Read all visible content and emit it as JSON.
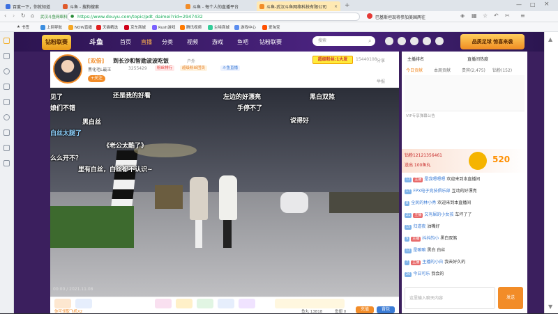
{
  "browser": {
    "tabs": [
      {
        "label": "百度一下，你就知道",
        "color": "#3b6fe0"
      },
      {
        "label": "斗鱼 - 搜狗搜索",
        "color": "#e05a2b"
      },
      {
        "label": "斗鱼 - 每个人的直播平台",
        "color": "#f28c28"
      },
      {
        "label": "斗鱼-武汉斗鱼网络科技有限公司",
        "color": "#f28c28"
      }
    ],
    "security_label": "武汉斗鱼网络科技有限公司",
    "url": "https://www.douyu.com/topic/pdt_daimei?rid=2947432",
    "news_text": "巴基斯坦现将参加美国两往",
    "bookmarks": [
      "书签",
      "上网导航",
      "NOW直播",
      "天猫精选",
      "京东商城",
      "Rush游戏",
      "腾讯视频",
      "尘埃商城",
      "游戏中心",
      "爱淘宝"
    ]
  },
  "site": {
    "logo": "斗鱼",
    "nav": [
      "首页",
      "直播",
      "分类",
      "视频",
      "游戏",
      "鱼吧",
      "钻粉联赛"
    ],
    "search_placeholder": "搜索",
    "promo": "钻粉联赛",
    "promo_banner": "品质足球 惊喜来袭"
  },
  "stream": {
    "tag": "[双倍]",
    "title": "到长沙和智勋波波吃饭",
    "follow_label": "+关注",
    "category": "户外",
    "streamer": "黑化毛L最王",
    "popularity": "3255429",
    "room_tags": [
      "粉丝排行",
      "超级粉丝团员",
      "斗鱼直播"
    ],
    "hot_label": "超级粉丝",
    "hot_value": "1大发",
    "room_id": "15440108",
    "share_label": "分享",
    "report_label": "举报"
  },
  "video_danmaku": [
    "见了",
    "还是我的好看",
    "左边的好漂亮",
    "黑白双煞",
    "娘们不错",
    "手停不了",
    "黑白丝",
    "说得好",
    "白丝太腿了",
    "《老公太酷了》",
    "么么开不？",
    "里有白丝，白丝都不认识~"
  ],
  "player": {
    "time": "00:00 / 2021.11.08",
    "gift_labels": [
      "超粉大厅",
      "充值",
      "福利大厅",
      "乐享",
      "乐发",
      "大豪猪",
      "宝箱"
    ],
    "hint": "你可领取飞机X2",
    "fish_label": "鱼丸 13818",
    "fishcoin_label": "鱼翅 0",
    "recharge_button": "充值",
    "bag_button": "背包"
  },
  "chat": {
    "rank_title": "主播排名",
    "heat_title": "直播间热度",
    "tabs": [
      "今日贡献",
      "本周贡献",
      "贵宾(2,475)",
      "钻粉(152)"
    ],
    "vip_note": "VIP专享弹幕公告",
    "gift_banner": {
      "user": "钻粉12121356461",
      "text": "送出 100鱼丸",
      "count": "520"
    },
    "lines": [
      {
        "level": "12",
        "badge": "主播",
        "nick": "是我嗯嗯嗯",
        "msg": "欢迎来到本直播间"
      },
      {
        "level": "17",
        "badge": "",
        "nick": "FPX电子竞技俱乐部",
        "msg": "互动的好漂亮"
      },
      {
        "level": "8",
        "badge": "",
        "nick": "全民的林小秀",
        "msg": "欢迎来到本直播间"
      },
      {
        "level": "21",
        "badge": "主播",
        "nick": "又有屎的小女孩",
        "msg": "车坏了了"
      },
      {
        "level": "15",
        "badge": "",
        "nick": "归道夜",
        "msg": "油嘴好"
      },
      {
        "level": "9",
        "badge": "主播",
        "nick": "抖抖的小",
        "msg": "黑白双煞"
      },
      {
        "level": "12",
        "badge": "",
        "nick": "是嘛嘛",
        "msg": "黑白 白丝"
      },
      {
        "level": "7",
        "badge": "主播",
        "nick": "主播的小白",
        "msg": "我去好久的"
      },
      {
        "level": "20",
        "badge": "",
        "nick": "今日可乐",
        "msg": "我会的 "
      }
    ],
    "input_placeholder": "这里输入聊天内容",
    "send_button": "发送"
  },
  "colors": {
    "brand": "#f28c28",
    "purple": "#3b1f5e",
    "chat_nick": "#3a7bd5"
  }
}
